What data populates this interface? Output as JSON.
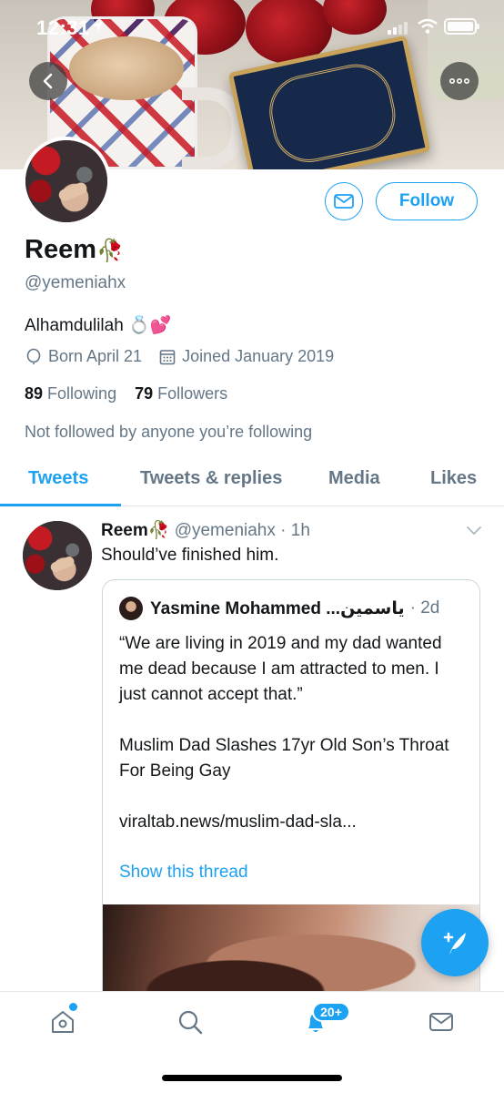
{
  "status_bar": {
    "time": "12:31"
  },
  "profile": {
    "name": "Reem",
    "name_emoji": "🥀",
    "handle": "@yemeniahx",
    "bio": "Alhamdulilah 💍💕",
    "born": "Born April 21",
    "joined": "Joined January 2019",
    "following_count": "89",
    "following_label": "Following",
    "followers_count": "79",
    "followers_label": "Followers",
    "not_followed": "Not followed by anyone you’re following",
    "follow_label": "Follow"
  },
  "tabs": [
    {
      "label": "Tweets",
      "active": true
    },
    {
      "label": "Tweets & replies",
      "active": false
    },
    {
      "label": "Media",
      "active": false
    },
    {
      "label": "Likes",
      "active": false
    }
  ],
  "tweet": {
    "name": "Reem",
    "name_emoji": "🥀",
    "handle": "@yemeniahx",
    "time": "· 1h",
    "text": "Should’ve finished him.",
    "quote": {
      "name": "Yasmine Mohammed ...ياسمين",
      "time": "· 2d",
      "body": "“We are living in 2019 and my dad wanted me dead because I am attracted to men. I just cannot accept that.”\n\nMuslim Dad Slashes 17yr Old Son’s Throat For Being Gay\n\nviraltab.news/muslim-dad-sla...",
      "link": "Show this thread"
    }
  },
  "bottom_nav": {
    "items": [
      "home-icon",
      "search-icon",
      "notifications-icon",
      "messages-icon"
    ],
    "notifications_badge": "20+"
  },
  "colors": {
    "accent": "#1da1f2",
    "secondary_text": "#657786",
    "border": "#e1e8ed"
  }
}
